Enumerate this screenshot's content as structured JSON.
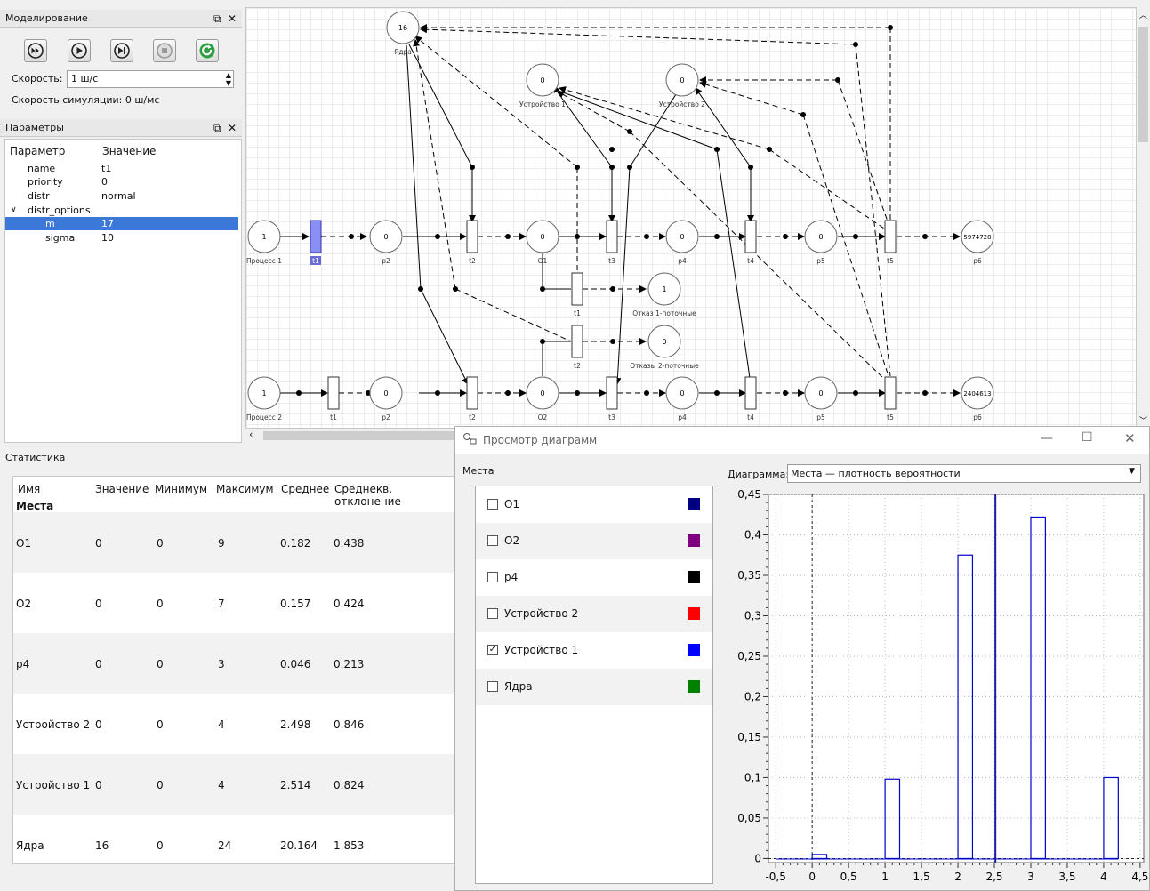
{
  "modeling": {
    "title": "Моделирование",
    "speed_label": "Скорость:",
    "speed_value": "1 ш/с",
    "sim_speed": "Скорость симуляции: 0 ш/мс",
    "buttons": [
      "fast-forward-icon",
      "play-icon",
      "step-icon",
      "stop-icon",
      "refresh-icon"
    ]
  },
  "params": {
    "title": "Параметры",
    "col_param": "Параметр",
    "col_value": "Значение",
    "rows": [
      {
        "name": "name",
        "value": "t1"
      },
      {
        "name": "priority",
        "value": "0"
      },
      {
        "name": "distr",
        "value": "normal"
      },
      {
        "name": "distr_options",
        "value": ""
      },
      {
        "name": "m",
        "value": "17"
      },
      {
        "name": "sigma",
        "value": "10"
      }
    ]
  },
  "net": {
    "row1": {
      "places": [
        {
          "label": "Процесс 1",
          "tokens": "1"
        },
        {
          "label": "p2",
          "tokens": "0"
        },
        {
          "label": "O1",
          "tokens": "0"
        },
        {
          "label": "p4",
          "tokens": "0"
        },
        {
          "label": "p5",
          "tokens": "0"
        },
        {
          "label": "p6",
          "tokens": "5974728"
        }
      ],
      "transitions": [
        "t1",
        "t2",
        "t3",
        "t4",
        "t5"
      ]
    },
    "row2": {
      "places": [
        {
          "label": "Процесс 2",
          "tokens": "1"
        },
        {
          "label": "p2",
          "tokens": "0"
        },
        {
          "label": "O2",
          "tokens": "0"
        },
        {
          "label": "p4",
          "tokens": "0"
        },
        {
          "label": "p5",
          "tokens": "0"
        },
        {
          "label": "p6",
          "tokens": "2404613"
        }
      ],
      "transitions": [
        "t1",
        "t2",
        "t3",
        "t4",
        "t5"
      ]
    },
    "top_places": [
      {
        "label": "Ядра",
        "tokens": "16"
      },
      {
        "label": "Устройство 1",
        "tokens": "0"
      },
      {
        "label": "Устройство 2",
        "tokens": "0"
      }
    ],
    "fail_places": [
      {
        "label": "Отказ 1-поточные",
        "tokens": "1"
      },
      {
        "label": "Отказы 2-поточные",
        "tokens": "0"
      }
    ],
    "mid_transitions": [
      "t1",
      "t2"
    ]
  },
  "stats": {
    "title": "Статистика",
    "headers": [
      "Имя",
      "Значение",
      "Минимум",
      "Максимум",
      "Среднее",
      "Среднекв. отклонение"
    ],
    "group": "Места",
    "rows": [
      [
        "O1",
        "0",
        "0",
        "9",
        "0.182",
        "0.438"
      ],
      [
        "O2",
        "0",
        "0",
        "7",
        "0.157",
        "0.424"
      ],
      [
        "p4",
        "0",
        "0",
        "3",
        "0.046",
        "0.213"
      ],
      [
        "Устройство 2",
        "0",
        "0",
        "4",
        "2.498",
        "0.846"
      ],
      [
        "Устройство 1",
        "0",
        "0",
        "4",
        "2.514",
        "0.824"
      ],
      [
        "Ядра",
        "16",
        "0",
        "24",
        "20.164",
        "1.853"
      ]
    ]
  },
  "diagram": {
    "title": "Просмотр диаграмм",
    "places_label": "Места",
    "diagram_label": "Диаграмма:",
    "diagram_value": "Места — плотность вероятности",
    "items": [
      {
        "name": "O1",
        "checked": false,
        "color": "#000080"
      },
      {
        "name": "O2",
        "checked": false,
        "color": "#800080"
      },
      {
        "name": "p4",
        "checked": false,
        "color": "#000000"
      },
      {
        "name": "Устройство 2",
        "checked": false,
        "color": "#ff0000"
      },
      {
        "name": "Устройство 1",
        "checked": true,
        "color": "#0000ff"
      },
      {
        "name": "Ядра",
        "checked": false,
        "color": "#008000"
      }
    ]
  },
  "chart_data": {
    "type": "bar",
    "series": [
      {
        "name": "Устройство 1",
        "x": [
          0,
          1,
          2,
          3,
          4
        ],
        "values": [
          0.005,
          0.098,
          0.375,
          0.422,
          0.1
        ]
      }
    ],
    "mean_line_x": 2.514,
    "zero_line_x": 0,
    "xlim": [
      -0.6,
      4.55
    ],
    "ylim": [
      -0.005,
      0.45
    ],
    "xticks": [
      "-0,5",
      "0",
      "0,5",
      "1",
      "1,5",
      "2",
      "2,5",
      "3",
      "3,5",
      "4",
      "4,5"
    ],
    "yticks": [
      "0",
      "0,05",
      "0,1",
      "0,15",
      "0,2",
      "0,25",
      "0,3",
      "0,35",
      "0,4",
      "0,45"
    ],
    "color": "#0000cc"
  }
}
